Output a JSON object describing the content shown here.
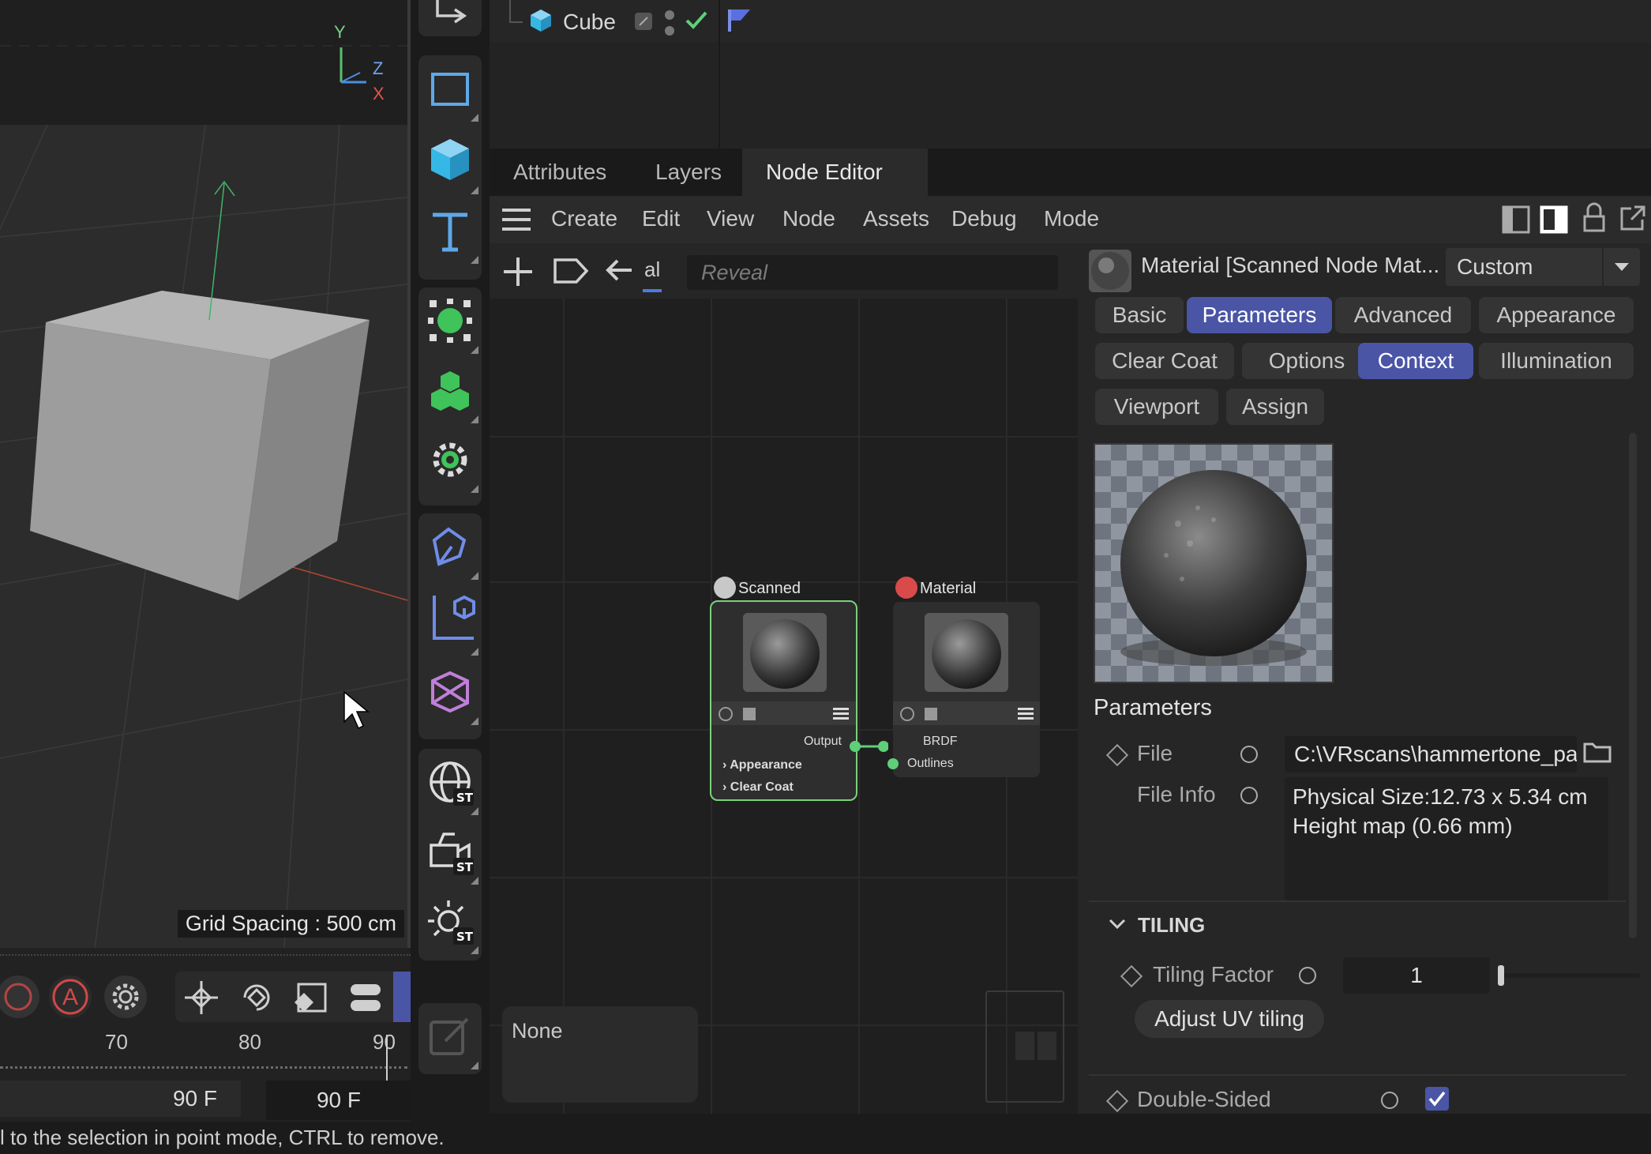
{
  "colors": {
    "accent": "#4a55a6",
    "selection_green": "#7bd17b",
    "port_green": "#5fcf7a",
    "cube_icon": "#35b8e6",
    "tool_green": "#3fc35a",
    "tool_blue": "#5fa8e8",
    "tool_purple": "#c07fd8",
    "material_red": "#d94a4a"
  },
  "viewport": {
    "axis_labels": {
      "y": "Y",
      "z": "Z",
      "x": "X"
    },
    "grid_spacing": "Grid Spacing : 500 cm"
  },
  "timeline": {
    "ruler_ticks": [
      "70",
      "80",
      "90"
    ],
    "frame_field_left": "90 F",
    "frame_field_right": "90 F",
    "autokey_label": "A"
  },
  "palette": {
    "icons": [
      "select-box-icon",
      "cube-primitive-icon",
      "text-spline-icon",
      "generator-icon",
      "cloner-icon",
      "deformer-gear-icon",
      "spline-pen-icon",
      "scene-axis-icon",
      "volume-icon",
      "environment-st-icon",
      "camera-st-icon",
      "light-st-icon",
      "edit-disabled-icon"
    ]
  },
  "object_manager": {
    "object_name": "Cube"
  },
  "tabs": [
    {
      "label": "Attributes"
    },
    {
      "label": "Layers"
    },
    {
      "label": "Node Editor"
    }
  ],
  "menu": [
    "Create",
    "Edit",
    "View",
    "Node",
    "Assets",
    "Debug",
    "Mode"
  ],
  "node_editor": {
    "toolbar_partial_label": "al",
    "search_placeholder": "Reveal",
    "none_label": "None",
    "nodes": {
      "scanned": {
        "title": "Scanned",
        "output_label": "Output",
        "groups": [
          "Appearance",
          "Clear Coat"
        ]
      },
      "material": {
        "title": "Material",
        "inputs": [
          "BRDF",
          "Outlines"
        ]
      }
    }
  },
  "attributes": {
    "title": "Material [Scanned Node Mat...",
    "mode_dropdown": "Custom",
    "chip_rows": [
      [
        {
          "label": "Basic",
          "active": false
        },
        {
          "label": "Parameters",
          "active": true
        },
        {
          "label": "Advanced",
          "active": false
        },
        {
          "label": "Appearance",
          "active": false
        }
      ],
      [
        {
          "label": "Clear Coat",
          "active": false
        },
        {
          "label": "Options",
          "active": false
        },
        {
          "label": "Context",
          "active": true
        },
        {
          "label": "Illumination",
          "active": false
        }
      ],
      [
        {
          "label": "Viewport",
          "active": false
        },
        {
          "label": "Assign",
          "active": false
        }
      ]
    ],
    "section_title": "Parameters",
    "file_label": "File",
    "file_value": "C:\\VRscans\\hammertone_pa",
    "file_info_label": "File Info",
    "file_info_line1": "Physical Size:12.73 x 5.34 cm",
    "file_info_line2": "Height map (0.66 mm)",
    "tiling_group": "TILING",
    "tiling_factor_label": "Tiling Factor",
    "tiling_factor_value": "1",
    "tiling_factor_slider": 0.0,
    "adjust_uv_button": "Adjust UV tiling",
    "double_sided_label": "Double-Sided",
    "double_sided_checked": true
  },
  "status_bar": {
    "text": "l to the selection in point mode, CTRL to remove."
  }
}
